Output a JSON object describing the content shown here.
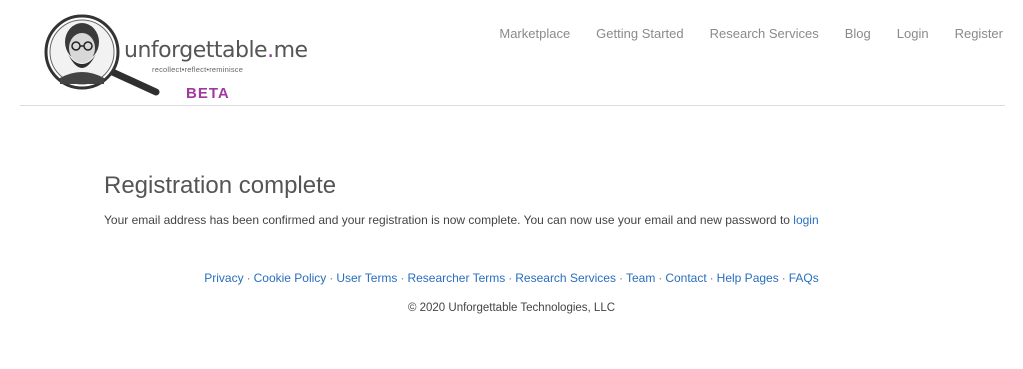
{
  "brand": {
    "wordmark_main": "unforgettable",
    "wordmark_dot": ".",
    "wordmark_tld": "me",
    "tagline": "recollect•reflect•reminisce",
    "beta": "BETA",
    "accent_color": "#a03aa0"
  },
  "nav": {
    "items": [
      {
        "label": "Marketplace"
      },
      {
        "label": "Getting Started"
      },
      {
        "label": "Research Services"
      },
      {
        "label": "Blog"
      },
      {
        "label": "Login"
      },
      {
        "label": "Register"
      }
    ]
  },
  "main": {
    "title": "Registration complete",
    "message": "Your email address has been confirmed and your registration is now complete. You can now use your email and new password to ",
    "login_link": "login"
  },
  "footer": {
    "links": [
      {
        "label": "Privacy"
      },
      {
        "label": "Cookie Policy"
      },
      {
        "label": "User Terms"
      },
      {
        "label": "Researcher Terms"
      },
      {
        "label": "Research Services"
      },
      {
        "label": "Team"
      },
      {
        "label": "Contact"
      },
      {
        "label": "Help Pages"
      },
      {
        "label": "FAQs"
      }
    ],
    "separator": "·",
    "copyright": "© 2020 Unforgettable Technologies, LLC"
  },
  "colors": {
    "link": "#2a6ebd",
    "nav_text": "#8a8a8a",
    "divider": "#dcdcdc"
  }
}
